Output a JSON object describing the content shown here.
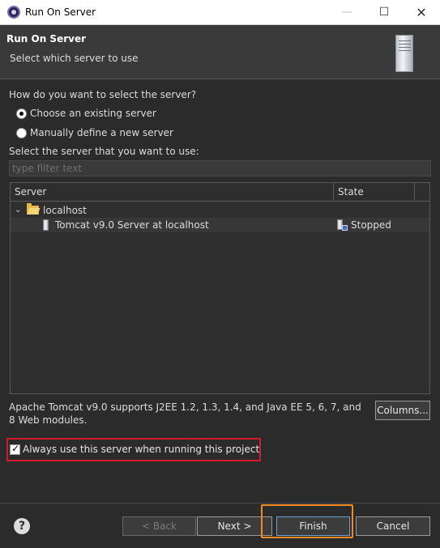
{
  "window": {
    "title": "Run On Server",
    "minimize_glyph": "—",
    "maximize_glyph": "☐",
    "close_glyph": "✕"
  },
  "banner": {
    "title": "Run On Server",
    "subtitle": "Select which server to use"
  },
  "selection": {
    "question": "How do you want to select the server?",
    "options": [
      {
        "label": "Choose an existing server",
        "selected": true
      },
      {
        "label": "Manually define a new server",
        "selected": false
      }
    ],
    "list_label": "Select the server that you want to use:",
    "filter_placeholder": "type filter text"
  },
  "table": {
    "columns": [
      "Server",
      "State"
    ],
    "rows": [
      {
        "name": "localhost",
        "state": "",
        "type": "folder",
        "expanded": true,
        "chevron": "⌄"
      },
      {
        "name": "Tomcat v9.0 Server at localhost",
        "state": "Stopped",
        "type": "server"
      }
    ]
  },
  "description": "Apache Tomcat v9.0 supports J2EE 1.2, 1.3, 1.4, and Java EE 5, 6, 7, and 8 Web modules.",
  "buttons": {
    "columns": "Columns...",
    "back": "< Back",
    "next": "Next >",
    "finish": "Finish",
    "cancel": "Cancel",
    "help": "?"
  },
  "always_use": {
    "label": "Always use this server when running this project",
    "checked": true
  },
  "colors": {
    "highlight_red": "#d11a2a",
    "highlight_orange": "#f08a24",
    "background": "#2b2b2b"
  }
}
